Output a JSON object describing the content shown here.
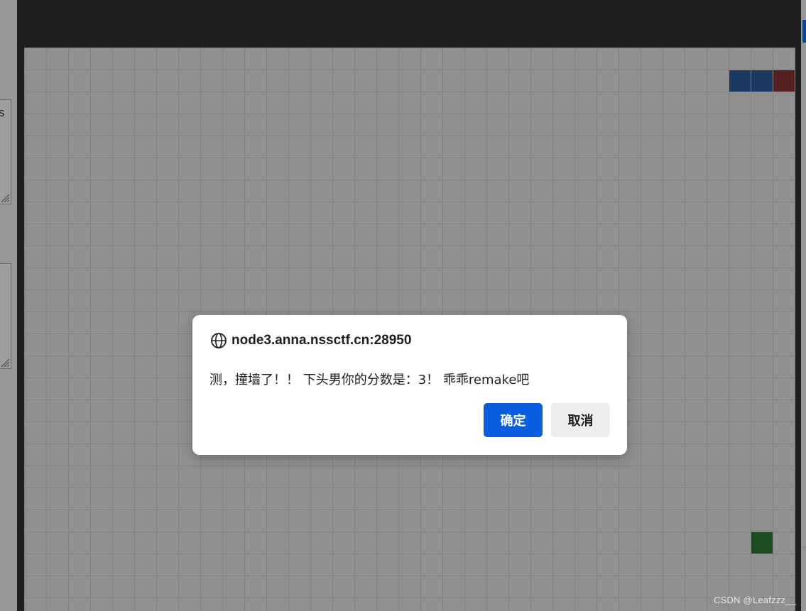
{
  "left_panel": {
    "textarea_1_fragment": "s"
  },
  "game": {
    "grid_cell_size": 31,
    "colors": {
      "board": "#e8e8ea",
      "grid": "#cfcfd2",
      "snake_body": "#2b5c9e",
      "snake_head": "#8b3535",
      "food": "#2f7a37"
    }
  },
  "dialog": {
    "origin": "node3.anna.nssctf.cn:28950",
    "message": "测，撞墙了！！ 下头男你的分数是：3！ 乖乖remake吧",
    "ok_label": "确定",
    "cancel_label": "取消",
    "icon": "globe-icon"
  },
  "watermark": "CSDN @Leafzzz__"
}
